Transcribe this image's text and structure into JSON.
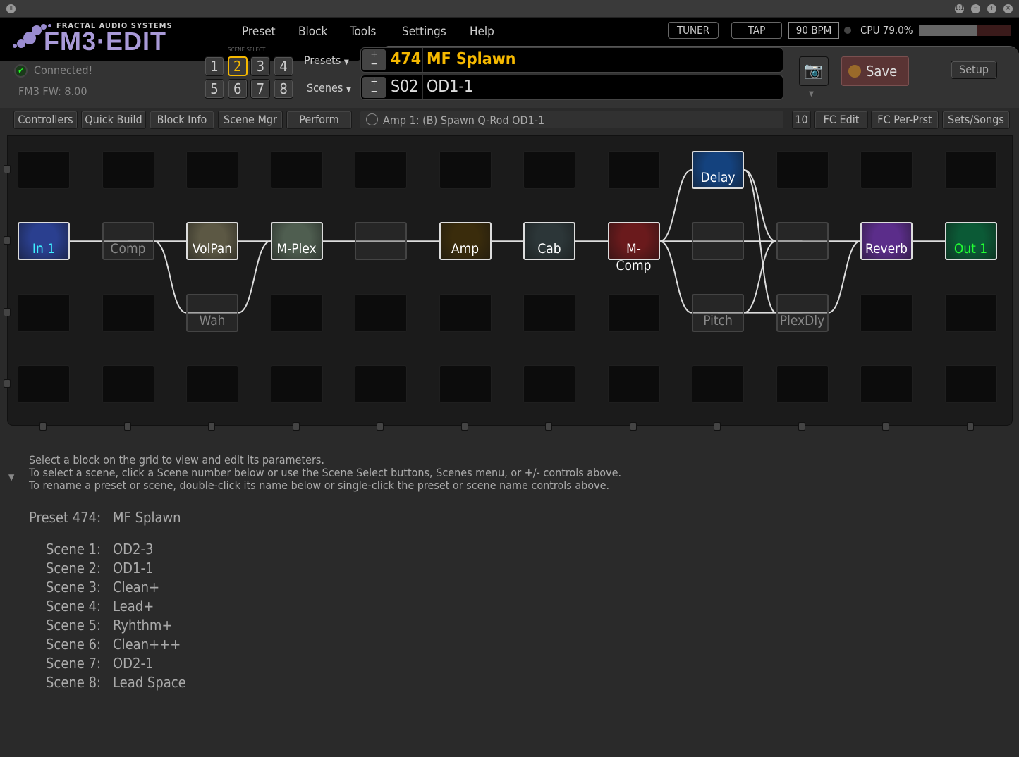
{
  "window": {
    "buttons": [
      "1:1",
      "−",
      "+",
      "×"
    ]
  },
  "logo": {
    "small": "FRACTAL AUDIO SYSTEMS",
    "big": "FM3·EDIT"
  },
  "menu": [
    "Preset",
    "Block",
    "Tools",
    "Settings",
    "Help"
  ],
  "header": {
    "tuner": "TUNER",
    "tap": "TAP",
    "bpm": "90 BPM",
    "cpu": "CPU 79.0%",
    "cpu_percent": 79.0
  },
  "status": {
    "connected": "Connected!",
    "firmware": "FM3 FW: 8.00"
  },
  "scene_select": {
    "label": "SCENE SELECT",
    "buttons": [
      "1",
      "2",
      "3",
      "4",
      "5",
      "6",
      "7",
      "8"
    ],
    "active": "2"
  },
  "preset": {
    "menu": "Presets",
    "number": "474",
    "name": "MF Splawn"
  },
  "scene": {
    "menu": "Scenes",
    "number": "S02",
    "name": "OD1-1"
  },
  "actions": {
    "save": "Save",
    "setup": "Setup"
  },
  "toolbar": {
    "left": [
      "Controllers",
      "Quick Build",
      "Block Info",
      "Scene Mgr",
      "Perform"
    ],
    "info": "Amp 1: (B) Spawn Q-Rod OD1-1",
    "right": [
      "10",
      "FC Edit",
      "FC Per-Prst",
      "Sets/Songs"
    ]
  },
  "grid": {
    "blocks": [
      {
        "label": "In 1",
        "row": 1,
        "col": 0,
        "color": "#2a3f8f",
        "text": "#3ef0ff"
      },
      {
        "label": "Comp",
        "row": 1,
        "col": 1,
        "bypassed": true
      },
      {
        "label": "VolPan",
        "row": 1,
        "col": 2,
        "color": "#5c5844"
      },
      {
        "label": "Wah",
        "row": 2,
        "col": 2,
        "bypassed": true
      },
      {
        "label": "M-Plex",
        "row": 1,
        "col": 3,
        "color": "#4f5e50"
      },
      {
        "label": "",
        "row": 1,
        "col": 4,
        "bypassed": true
      },
      {
        "label": "Amp",
        "row": 1,
        "col": 5,
        "color": "#3a2c0c"
      },
      {
        "label": "Cab",
        "row": 1,
        "col": 6,
        "color": "#2c3638"
      },
      {
        "label": "M-Comp",
        "row": 1,
        "col": 7,
        "color": "#6a1a1c"
      },
      {
        "label": "Delay",
        "row": 0,
        "col": 8,
        "color": "#14427e"
      },
      {
        "label": "",
        "row": 1,
        "col": 8,
        "bypassed": true
      },
      {
        "label": "Pitch",
        "row": 2,
        "col": 8,
        "bypassed": true
      },
      {
        "label": "",
        "row": 1,
        "col": 9,
        "bypassed": true
      },
      {
        "label": "PlexDly",
        "row": 2,
        "col": 9,
        "bypassed": true
      },
      {
        "label": "Reverb",
        "row": 1,
        "col": 10,
        "color": "#5b2d8a"
      },
      {
        "label": "Out 1",
        "row": 1,
        "col": 11,
        "color": "#0b5a36",
        "text": "#22ff33"
      }
    ],
    "connections": [
      [
        [
          1,
          0
        ],
        [
          1,
          1
        ]
      ],
      [
        [
          1,
          1
        ],
        [
          1,
          2
        ]
      ],
      [
        [
          1,
          1
        ],
        [
          2,
          2
        ]
      ],
      [
        [
          1,
          2
        ],
        [
          1,
          3
        ]
      ],
      [
        [
          2,
          2
        ],
        [
          1,
          3
        ]
      ],
      [
        [
          1,
          3
        ],
        [
          1,
          4
        ]
      ],
      [
        [
          1,
          4
        ],
        [
          1,
          5
        ]
      ],
      [
        [
          1,
          5
        ],
        [
          1,
          6
        ]
      ],
      [
        [
          1,
          6
        ],
        [
          1,
          7
        ]
      ],
      [
        [
          1,
          7
        ],
        [
          0,
          8
        ]
      ],
      [
        [
          1,
          7
        ],
        [
          1,
          8
        ]
      ],
      [
        [
          1,
          7
        ],
        [
          2,
          8
        ]
      ],
      [
        [
          0,
          8
        ],
        [
          1,
          9
        ]
      ],
      [
        [
          0,
          8
        ],
        [
          2,
          9
        ]
      ],
      [
        [
          1,
          8
        ],
        [
          1,
          9
        ]
      ],
      [
        [
          2,
          8
        ],
        [
          1,
          9
        ]
      ],
      [
        [
          2,
          8
        ],
        [
          2,
          9
        ]
      ],
      [
        [
          1,
          9
        ],
        [
          1,
          10
        ]
      ],
      [
        [
          2,
          9
        ],
        [
          1,
          10
        ]
      ],
      [
        [
          1,
          10
        ],
        [
          1,
          11
        ]
      ]
    ]
  },
  "help": [
    "Select a block on the grid to view and edit its parameters.",
    "To select a scene, click a Scene number below or use the Scene Select buttons, Scenes menu, or +/- controls above.",
    "To rename a preset or scene, double-click its name below or single-click the preset or scene name controls above."
  ],
  "summary": {
    "preset_label": "Preset 474:",
    "preset_name": "MF Splawn",
    "scenes": [
      {
        "label": "Scene 1:",
        "name": "OD2-3"
      },
      {
        "label": "Scene 2:",
        "name": "OD1-1"
      },
      {
        "label": "Scene 3:",
        "name": "Clean+"
      },
      {
        "label": "Scene 4:",
        "name": "Lead+"
      },
      {
        "label": "Scene 5:",
        "name": "Ryhthm+"
      },
      {
        "label": "Scene 6:",
        "name": "Clean+++"
      },
      {
        "label": "Scene 7:",
        "name": "OD2-1"
      },
      {
        "label": "Scene 8:",
        "name": "Lead Space"
      }
    ]
  },
  "colors": {
    "accent": "#f5b800",
    "save_bg": "#5a3434"
  }
}
